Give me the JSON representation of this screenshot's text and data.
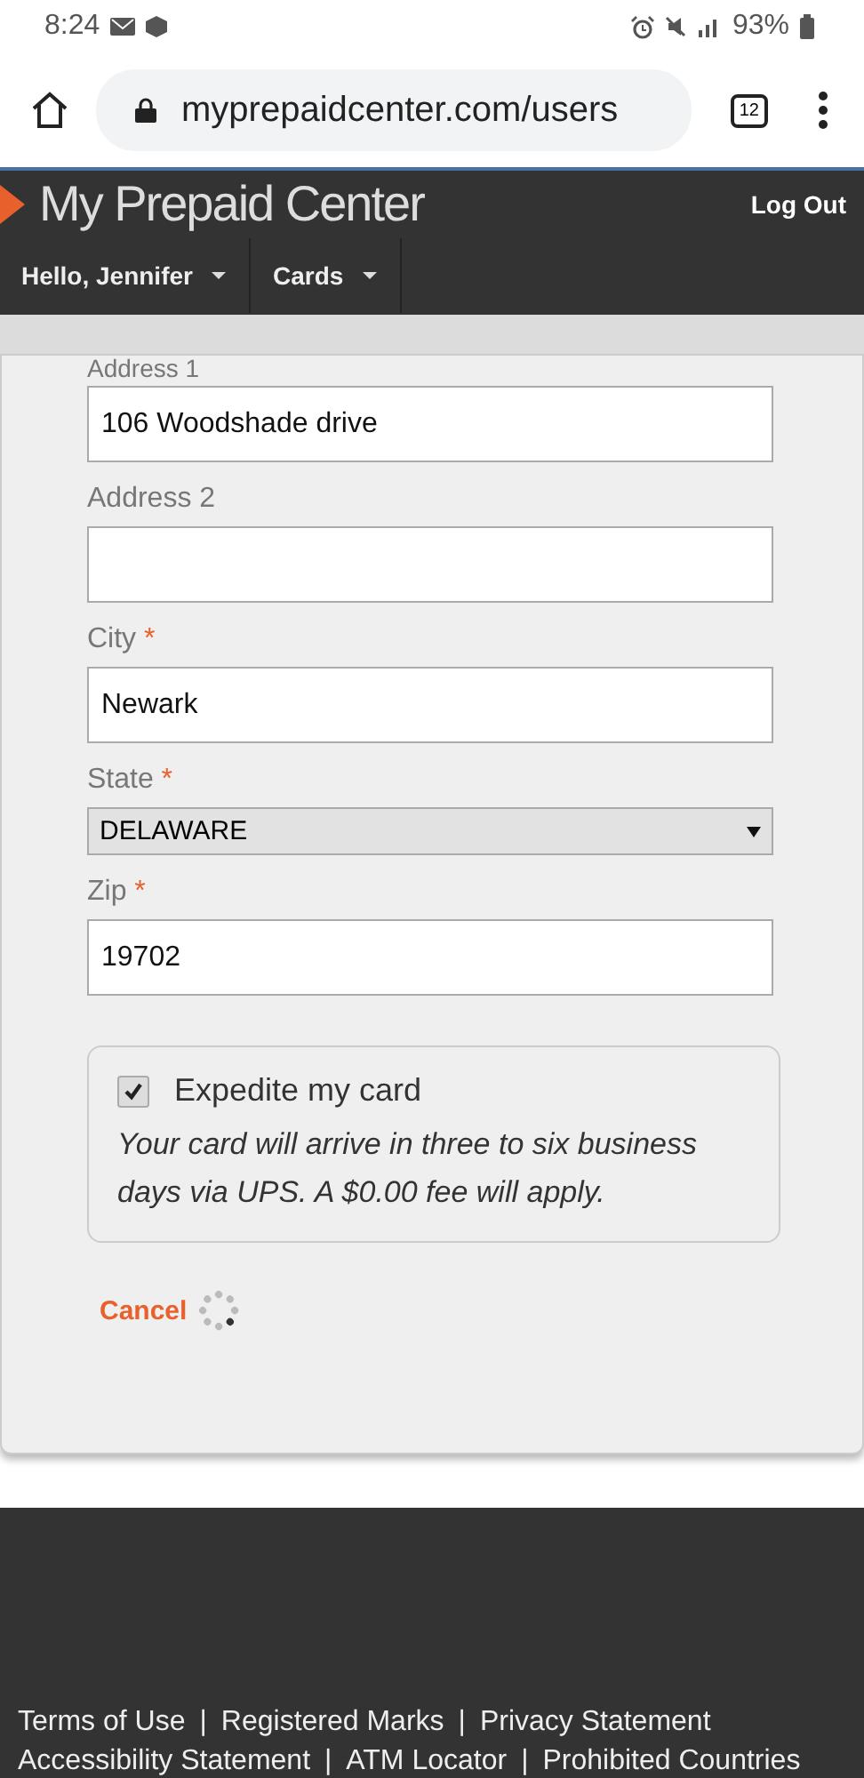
{
  "status_bar": {
    "time": "8:24",
    "battery": "93%"
  },
  "browser": {
    "url": "myprepaidcenter.com/users",
    "tab_count": "12"
  },
  "header": {
    "logo": "My Prepaid Center",
    "logout": "Log Out",
    "menus": [
      {
        "label": "Hello, Jennifer"
      },
      {
        "label": "Cards"
      }
    ]
  },
  "form": {
    "fields": [
      {
        "kind": "text",
        "label": "Address 1",
        "required": false,
        "value": "106 Woodshade drive"
      },
      {
        "kind": "text",
        "label": "Address 2",
        "required": false
      },
      {
        "kind": "text",
        "label": "City",
        "required": true,
        "value": "Newark"
      },
      {
        "kind": "select",
        "label": "State",
        "required": true,
        "value": "DELAWARE"
      },
      {
        "kind": "text",
        "label": "Zip",
        "required": true,
        "value": "19702"
      }
    ],
    "required_mark": "*",
    "expedite": {
      "label": "Expedite my card",
      "checked": true,
      "note": "Your card will arrive in three to six business days via UPS. A $0.00 fee will apply."
    },
    "cancel": "Cancel"
  },
  "footer": {
    "separator": "|",
    "rows": [
      [
        "Terms of Use",
        "Registered Marks",
        "Privacy Statement"
      ],
      [
        "Accessibility Statement",
        "ATM Locator",
        "Prohibited Countries"
      ]
    ]
  }
}
